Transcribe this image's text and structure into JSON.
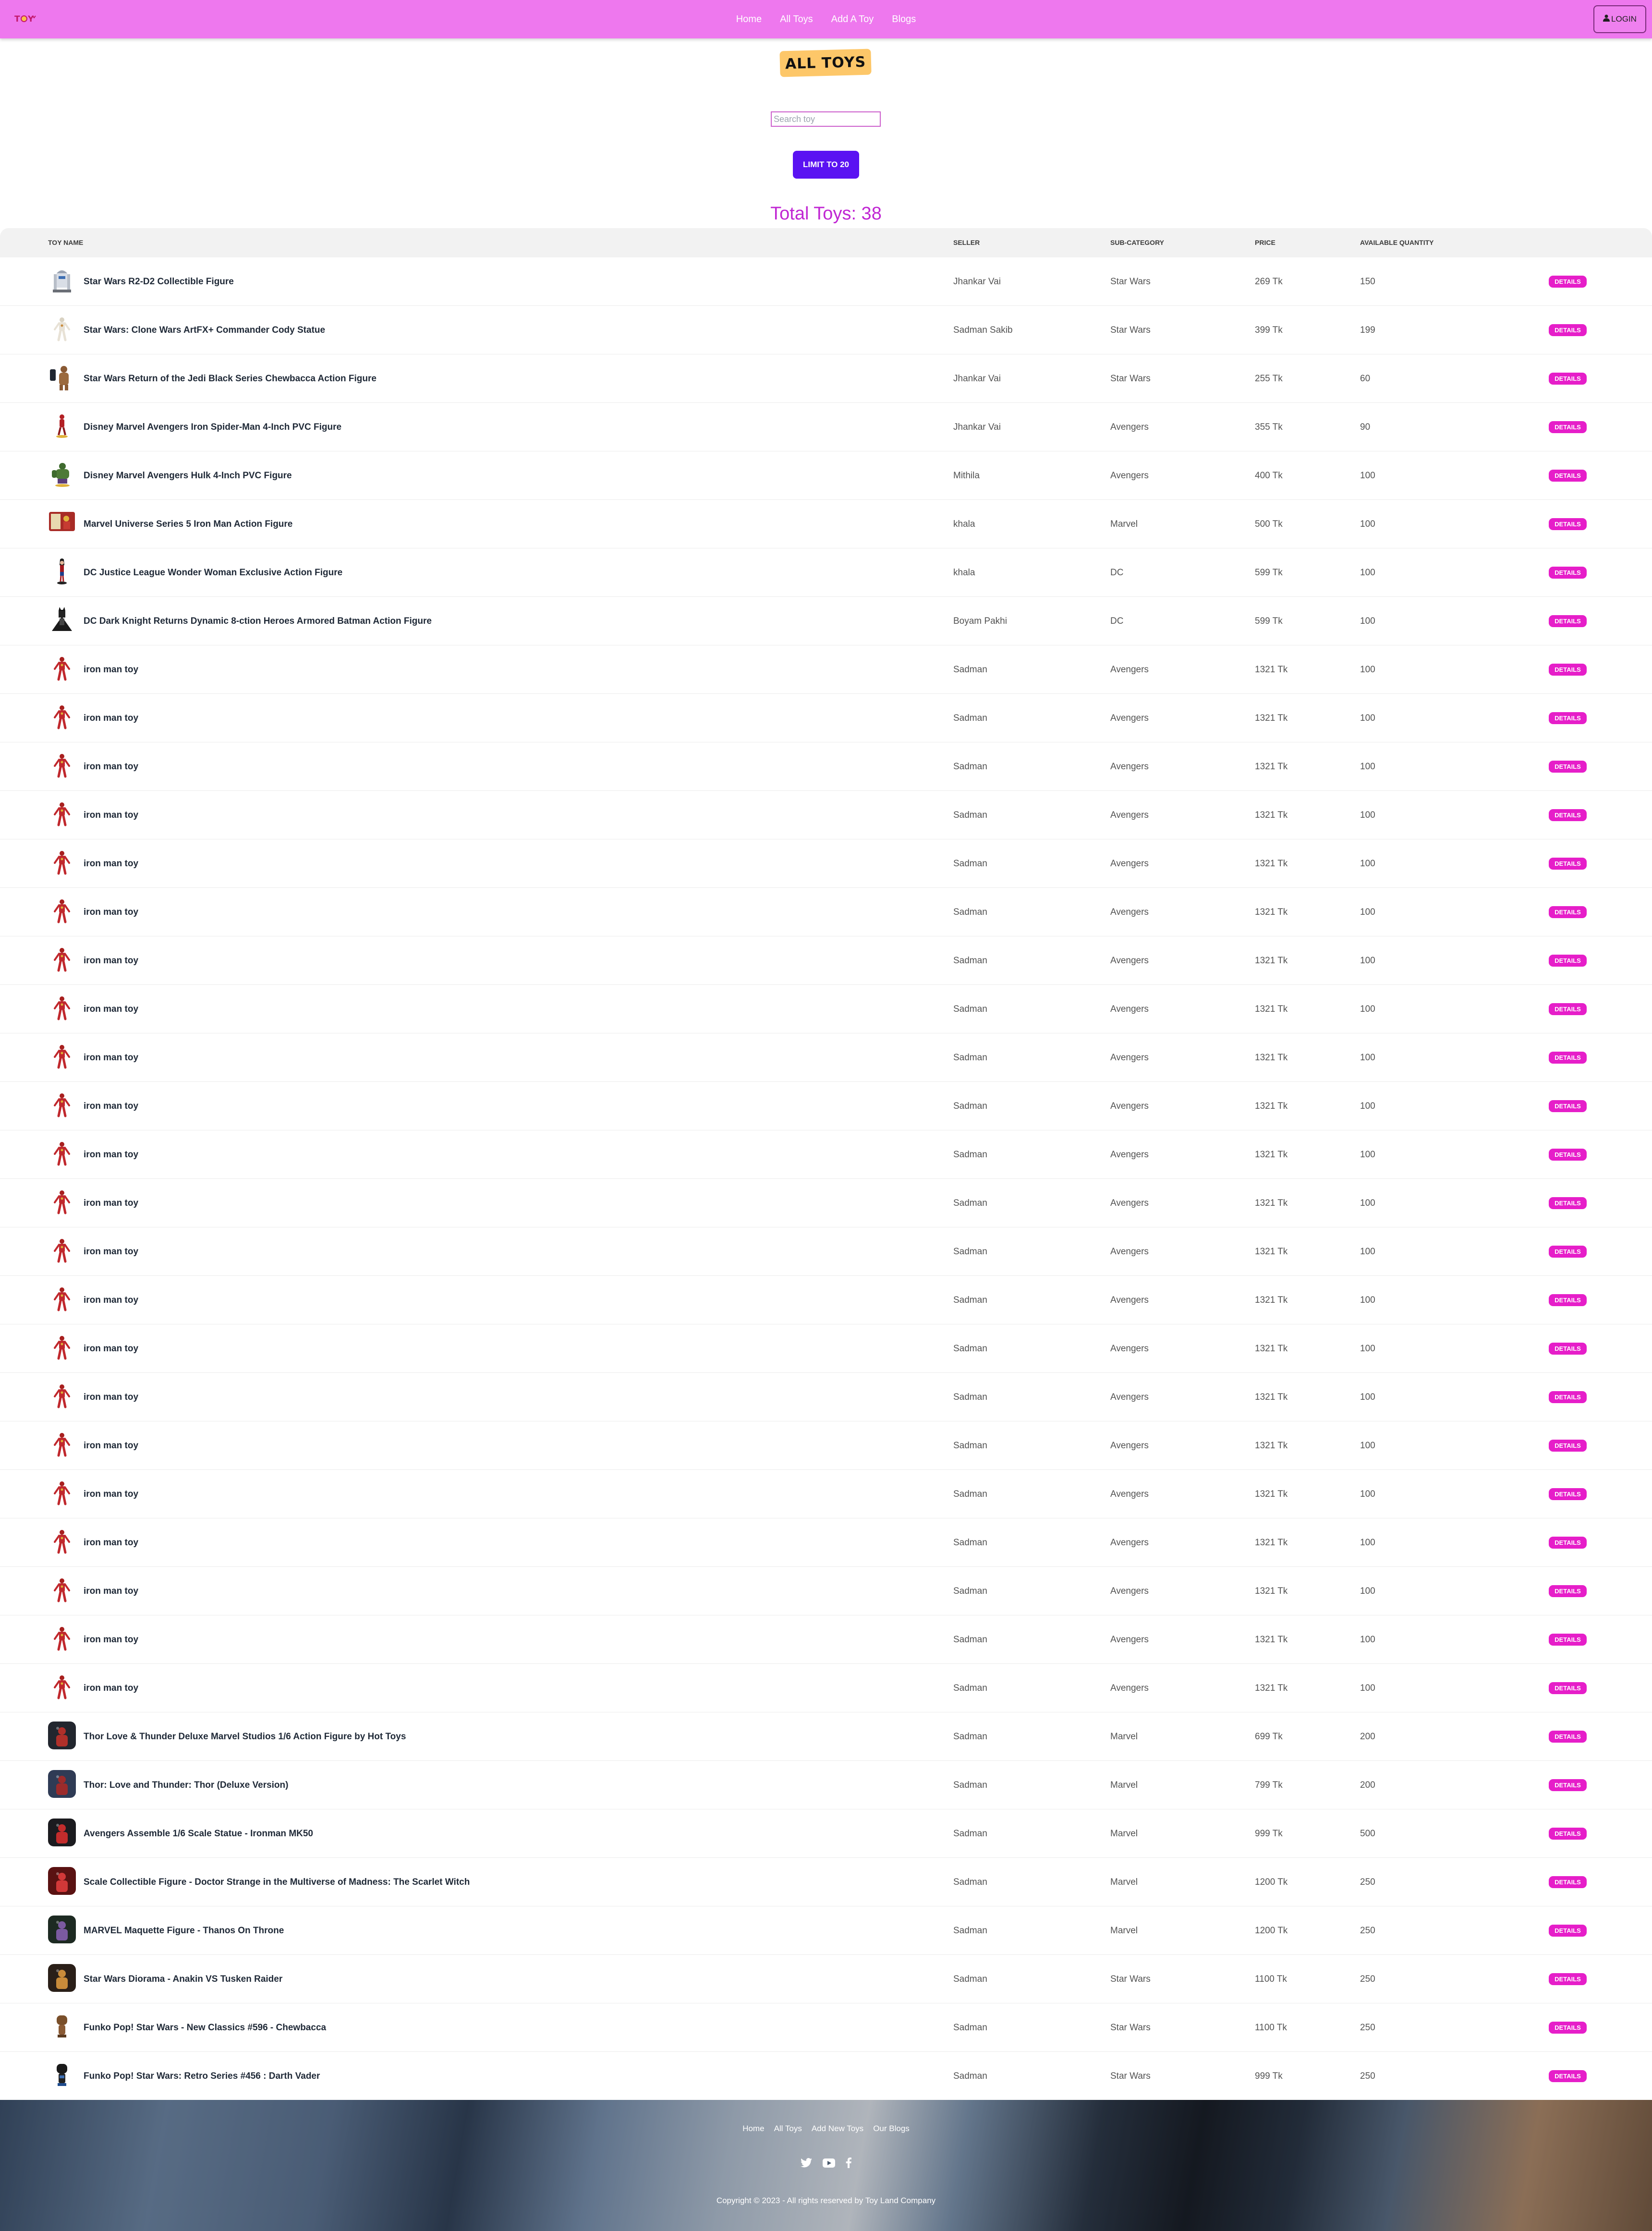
{
  "navbar": {
    "links": [
      "Home",
      "All Toys",
      "Add A Toy",
      "Blogs"
    ],
    "login_label": "LOGIN",
    "accent": "#ee78ee"
  },
  "page": {
    "heading": "ALL TOYS",
    "search_placeholder": "Search toy",
    "limit_button": "LIMIT TO 20",
    "total_label": "Total Toys: 38"
  },
  "table": {
    "headers": [
      "TOY NAME",
      "SELLER",
      "SUB-CATEGORY",
      "PRICE",
      "AVAILABLE QUANTITY"
    ],
    "details_label": "DETAILS",
    "rows": [
      {
        "name": "Star Wars R2-D2 Collectible Figure",
        "seller": "Jhankar Vai",
        "subcategory": "Star Wars",
        "price": "269 Tk",
        "quantity": "150",
        "icon": "r2d2-figure-icon"
      },
      {
        "name": "Star Wars: Clone Wars ArtFX+ Commander Cody Statue",
        "seller": "Sadman Sakib",
        "subcategory": "Star Wars",
        "price": "399 Tk",
        "quantity": "199",
        "icon": "clone-trooper-icon"
      },
      {
        "name": "Star Wars Return of the Jedi Black Series Chewbacca Action Figure",
        "seller": "Jhankar Vai",
        "subcategory": "Star Wars",
        "price": "255 Tk",
        "quantity": "60",
        "icon": "chewbacca-icon"
      },
      {
        "name": "Disney Marvel Avengers Iron Spider-Man 4-Inch PVC Figure",
        "seller": "Jhankar Vai",
        "subcategory": "Avengers",
        "price": "355 Tk",
        "quantity": "90",
        "icon": "spiderman-icon"
      },
      {
        "name": "Disney Marvel Avengers Hulk 4-Inch PVC Figure",
        "seller": "Mithila",
        "subcategory": "Avengers",
        "price": "400 Tk",
        "quantity": "100",
        "icon": "hulk-icon"
      },
      {
        "name": "Marvel Universe Series 5 Iron Man Action Figure",
        "seller": "khala",
        "subcategory": "Marvel",
        "price": "500 Tk",
        "quantity": "100",
        "icon": "ironman-box-icon"
      },
      {
        "name": "DC Justice League Wonder Woman Exclusive Action Figure",
        "seller": "khala",
        "subcategory": "DC",
        "price": "599 Tk",
        "quantity": "100",
        "icon": "wonder-woman-icon"
      },
      {
        "name": "DC Dark Knight Returns Dynamic 8-ction Heroes Armored Batman Action Figure",
        "seller": "Boyam Pakhi",
        "subcategory": "DC",
        "price": "599 Tk",
        "quantity": "100",
        "icon": "batman-icon"
      },
      {
        "name": "iron man toy",
        "seller": "Sadman",
        "subcategory": "Avengers",
        "price": "1321 Tk",
        "quantity": "100",
        "icon": "ironman-icon"
      },
      {
        "name": "iron man toy",
        "seller": "Sadman",
        "subcategory": "Avengers",
        "price": "1321 Tk",
        "quantity": "100",
        "icon": "ironman-icon"
      },
      {
        "name": "iron man toy",
        "seller": "Sadman",
        "subcategory": "Avengers",
        "price": "1321 Tk",
        "quantity": "100",
        "icon": "ironman-icon"
      },
      {
        "name": "iron man toy",
        "seller": "Sadman",
        "subcategory": "Avengers",
        "price": "1321 Tk",
        "quantity": "100",
        "icon": "ironman-icon"
      },
      {
        "name": "iron man toy",
        "seller": "Sadman",
        "subcategory": "Avengers",
        "price": "1321 Tk",
        "quantity": "100",
        "icon": "ironman-icon"
      },
      {
        "name": "iron man toy",
        "seller": "Sadman",
        "subcategory": "Avengers",
        "price": "1321 Tk",
        "quantity": "100",
        "icon": "ironman-icon"
      },
      {
        "name": "iron man toy",
        "seller": "Sadman",
        "subcategory": "Avengers",
        "price": "1321 Tk",
        "quantity": "100",
        "icon": "ironman-icon"
      },
      {
        "name": "iron man toy",
        "seller": "Sadman",
        "subcategory": "Avengers",
        "price": "1321 Tk",
        "quantity": "100",
        "icon": "ironman-icon"
      },
      {
        "name": "iron man toy",
        "seller": "Sadman",
        "subcategory": "Avengers",
        "price": "1321 Tk",
        "quantity": "100",
        "icon": "ironman-icon"
      },
      {
        "name": "iron man toy",
        "seller": "Sadman",
        "subcategory": "Avengers",
        "price": "1321 Tk",
        "quantity": "100",
        "icon": "ironman-icon"
      },
      {
        "name": "iron man toy",
        "seller": "Sadman",
        "subcategory": "Avengers",
        "price": "1321 Tk",
        "quantity": "100",
        "icon": "ironman-icon"
      },
      {
        "name": "iron man toy",
        "seller": "Sadman",
        "subcategory": "Avengers",
        "price": "1321 Tk",
        "quantity": "100",
        "icon": "ironman-icon"
      },
      {
        "name": "iron man toy",
        "seller": "Sadman",
        "subcategory": "Avengers",
        "price": "1321 Tk",
        "quantity": "100",
        "icon": "ironman-icon"
      },
      {
        "name": "iron man toy",
        "seller": "Sadman",
        "subcategory": "Avengers",
        "price": "1321 Tk",
        "quantity": "100",
        "icon": "ironman-icon"
      },
      {
        "name": "iron man toy",
        "seller": "Sadman",
        "subcategory": "Avengers",
        "price": "1321 Tk",
        "quantity": "100",
        "icon": "ironman-icon"
      },
      {
        "name": "iron man toy",
        "seller": "Sadman",
        "subcategory": "Avengers",
        "price": "1321 Tk",
        "quantity": "100",
        "icon": "ironman-icon"
      },
      {
        "name": "iron man toy",
        "seller": "Sadman",
        "subcategory": "Avengers",
        "price": "1321 Tk",
        "quantity": "100",
        "icon": "ironman-icon"
      },
      {
        "name": "iron man toy",
        "seller": "Sadman",
        "subcategory": "Avengers",
        "price": "1321 Tk",
        "quantity": "100",
        "icon": "ironman-icon"
      },
      {
        "name": "iron man toy",
        "seller": "Sadman",
        "subcategory": "Avengers",
        "price": "1321 Tk",
        "quantity": "100",
        "icon": "ironman-icon"
      },
      {
        "name": "iron man toy",
        "seller": "Sadman",
        "subcategory": "Avengers",
        "price": "1321 Tk",
        "quantity": "100",
        "icon": "ironman-icon"
      },
      {
        "name": "iron man toy",
        "seller": "Sadman",
        "subcategory": "Avengers",
        "price": "1321 Tk",
        "quantity": "100",
        "icon": "ironman-icon"
      },
      {
        "name": "iron man toy",
        "seller": "Sadman",
        "subcategory": "Avengers",
        "price": "1321 Tk",
        "quantity": "100",
        "icon": "ironman-icon"
      },
      {
        "name": "Thor Love & Thunder Deluxe Marvel Studios 1/6 Action Figure by Hot Toys",
        "seller": "Sadman",
        "subcategory": "Marvel",
        "price": "699 Tk",
        "quantity": "200",
        "icon": "thor-icon"
      },
      {
        "name": "Thor: Love and Thunder: Thor (Deluxe Version)",
        "seller": "Sadman",
        "subcategory": "Marvel",
        "price": "799 Tk",
        "quantity": "200",
        "icon": "thor-deluxe-icon"
      },
      {
        "name": "Avengers Assemble 1/6 Scale Statue - Ironman MK50",
        "seller": "Sadman",
        "subcategory": "Marvel",
        "price": "999 Tk",
        "quantity": "500",
        "icon": "ironman-mk50-icon"
      },
      {
        "name": "Scale Collectible Figure - Doctor Strange in the Multiverse of Madness: The Scarlet Witch",
        "seller": "Sadman",
        "subcategory": "Marvel",
        "price": "1200 Tk",
        "quantity": "250",
        "icon": "scarlet-witch-icon"
      },
      {
        "name": "MARVEL Maquette Figure - Thanos On Throne",
        "seller": "Sadman",
        "subcategory": "Marvel",
        "price": "1200 Tk",
        "quantity": "250",
        "icon": "thanos-icon"
      },
      {
        "name": "Star Wars Diorama - Anakin VS Tusken Raider",
        "seller": "Sadman",
        "subcategory": "Star Wars",
        "price": "1100 Tk",
        "quantity": "250",
        "icon": "anakin-icon"
      },
      {
        "name": "Funko Pop! Star Wars - New Classics #596 - Chewbacca",
        "seller": "Sadman",
        "subcategory": "Star Wars",
        "price": "1100 Tk",
        "quantity": "250",
        "icon": "funko-chewbacca-icon"
      },
      {
        "name": "Funko Pop! Star Wars: Retro Series #456 : Darth Vader",
        "seller": "Sadman",
        "subcategory": "Star Wars",
        "price": "999 Tk",
        "quantity": "250",
        "icon": "funko-vader-icon"
      }
    ]
  },
  "footer": {
    "links": [
      "Home",
      "All Toys",
      "Add New Toys",
      "Our Blogs"
    ],
    "social_icons": [
      "twitter-icon",
      "youtube-icon",
      "facebook-icon"
    ],
    "copyright": "Copyright © 2023 - All rights reserved by Toy Land Company"
  },
  "colors": {
    "details_button": "#e61ec9",
    "limit_button": "#5a12f2",
    "total_text": "#c026d3",
    "heading_badge": "#fdc769"
  }
}
